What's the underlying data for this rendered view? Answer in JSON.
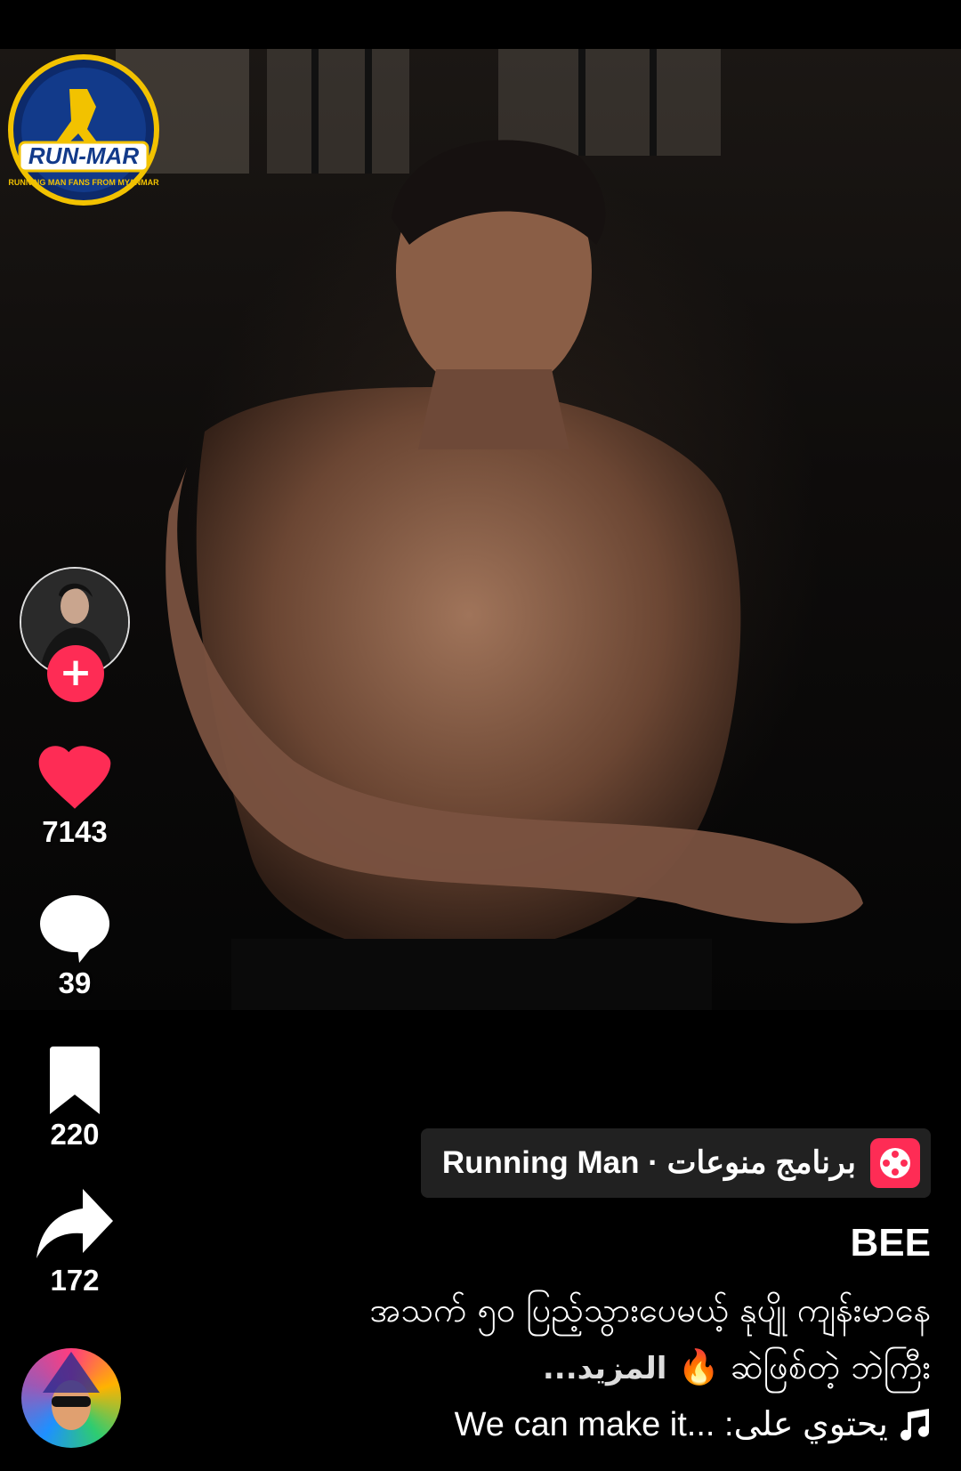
{
  "logo": {
    "text": "RUN-MAR",
    "subtext": "RUNNING MAN FANS FROM MYANMAR"
  },
  "rail": {
    "likes": "7143",
    "comments": "39",
    "saves": "220",
    "shares": "172"
  },
  "topic": {
    "label": "Running Man · برنامج منوعات"
  },
  "post": {
    "author": "BEE",
    "caption_line1": "အသက် ၅၀ ပြည့်သွားပေမယ့် နုပျို ကျန်းမာနေ",
    "caption_line2": "ဆဲဖြစ်တဲ့ ဘဲကြီး",
    "caption_emoji": "🔥",
    "more_label": "...المزيد"
  },
  "sound": {
    "label": "We can make it... :يحتوي على"
  },
  "colors": {
    "accent": "#fe2c55",
    "like": "#fe2c55"
  }
}
